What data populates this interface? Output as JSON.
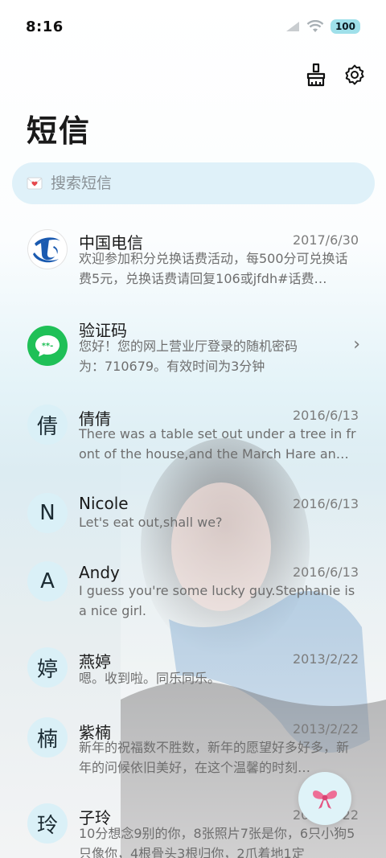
{
  "status_bar": {
    "time": "8:16",
    "battery": "100",
    "icons": [
      "signal-icon",
      "wifi-icon",
      "battery-icon"
    ]
  },
  "toolbar": {
    "icons": [
      "brush-clean-icon",
      "gear-icon"
    ]
  },
  "header": {
    "title": "短信"
  },
  "search": {
    "icon": "envelope-icon",
    "placeholder": "搜索短信"
  },
  "conversations": [
    {
      "name": "中国电信",
      "date": "2017/6/30",
      "preview": "欢迎参加积分兑换话费活动，每500分可兑换话费5元，兑换话费请回复106或jfdh#话费…",
      "avatar": {
        "type": "logo",
        "icon": "china-telecom-logo-icon"
      }
    },
    {
      "name": "验证码",
      "date": "",
      "preview": "您好！您的网上营业厅登录的随机密码为：710679。有效时间为3分钟",
      "avatar": {
        "type": "icon",
        "icon": "message-bubble-icon"
      },
      "has_chevron": true
    },
    {
      "name": "倩倩",
      "date": "2016/6/13",
      "preview": "There was a table set out under a tree in front of the house,and the March Hare an…",
      "avatar": {
        "type": "letter",
        "char": "倩"
      }
    },
    {
      "name": "Nicole",
      "date": "2016/6/13",
      "preview": "Let's eat out,shall we?",
      "avatar": {
        "type": "letter",
        "char": "N"
      }
    },
    {
      "name": "Andy",
      "date": "2016/6/13",
      "preview": "I guess you're some lucky guy.Stephanie is a nice girl.",
      "avatar": {
        "type": "letter",
        "char": "A"
      }
    },
    {
      "name": "燕婷",
      "date": "2013/2/22",
      "preview": "嗯。收到啦。同乐同乐。",
      "avatar": {
        "type": "letter",
        "char": "婷"
      }
    },
    {
      "name": "紫楠",
      "date": "2013/2/22",
      "preview": "新年的祝福数不胜数，新年的愿望好多好多，新年的问候依旧美好，在这个温馨的时刻…",
      "avatar": {
        "type": "letter",
        "char": "楠"
      }
    },
    {
      "name": "子玲",
      "date": "2013/2/22",
      "preview": "10分想念9别的你，8张照片7张是你，6只小狗5只像你，4根骨头3根归你，2爪着地1定",
      "avatar": {
        "type": "letter",
        "char": "玲"
      }
    }
  ],
  "fab": {
    "icon": "bow-icon"
  }
}
